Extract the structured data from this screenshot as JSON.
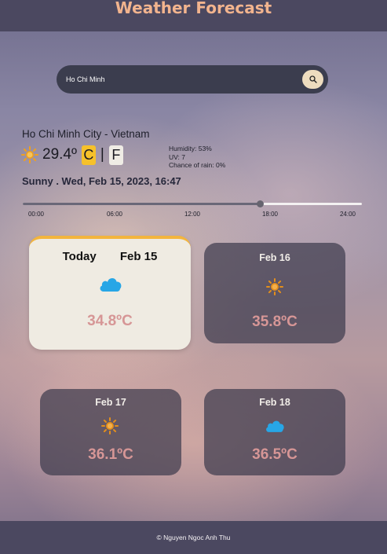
{
  "header": {
    "title": "Weather Forecast"
  },
  "search": {
    "value": "Ho Chi Minh"
  },
  "current": {
    "location": "Ho Chi Minh City - Vietnam",
    "temperature": "29.4º",
    "unit_c": "C",
    "separator": "|",
    "unit_f": "F",
    "humidity": "Humidity: 53%",
    "uv": "UV: 7",
    "rain": "Chance of rain: 0%",
    "condition": "Sunny . Wed, Feb 15, 2023, 16:47",
    "icon": "sun-icon"
  },
  "timeline": {
    "ticks": [
      "00:00",
      "06:00",
      "12:00",
      "18:00",
      "24:00"
    ],
    "progress": 0.6993
  },
  "forecast": [
    {
      "label": "Today",
      "date": "Feb 15",
      "icon": "cloud-icon",
      "temp": "34.8ºC"
    },
    {
      "date": "Feb 16",
      "icon": "sun-icon",
      "temp": "35.8ºC"
    },
    {
      "date": "Feb 17",
      "icon": "sun-icon",
      "temp": "36.1ºC"
    },
    {
      "date": "Feb 18",
      "icon": "cloud-icon",
      "temp": "36.5ºC"
    }
  ],
  "footer": {
    "text": "© Nguyen Ngoc Anh Thu"
  },
  "colors": {
    "header_bg": "#4b4860",
    "title": "#f2b48e",
    "unit_active": "#f6c12a",
    "card_today_border": "#f3b53d",
    "card_temp": "#d69696",
    "sun": "#f0a11d",
    "cloud": "#27a6e6"
  }
}
